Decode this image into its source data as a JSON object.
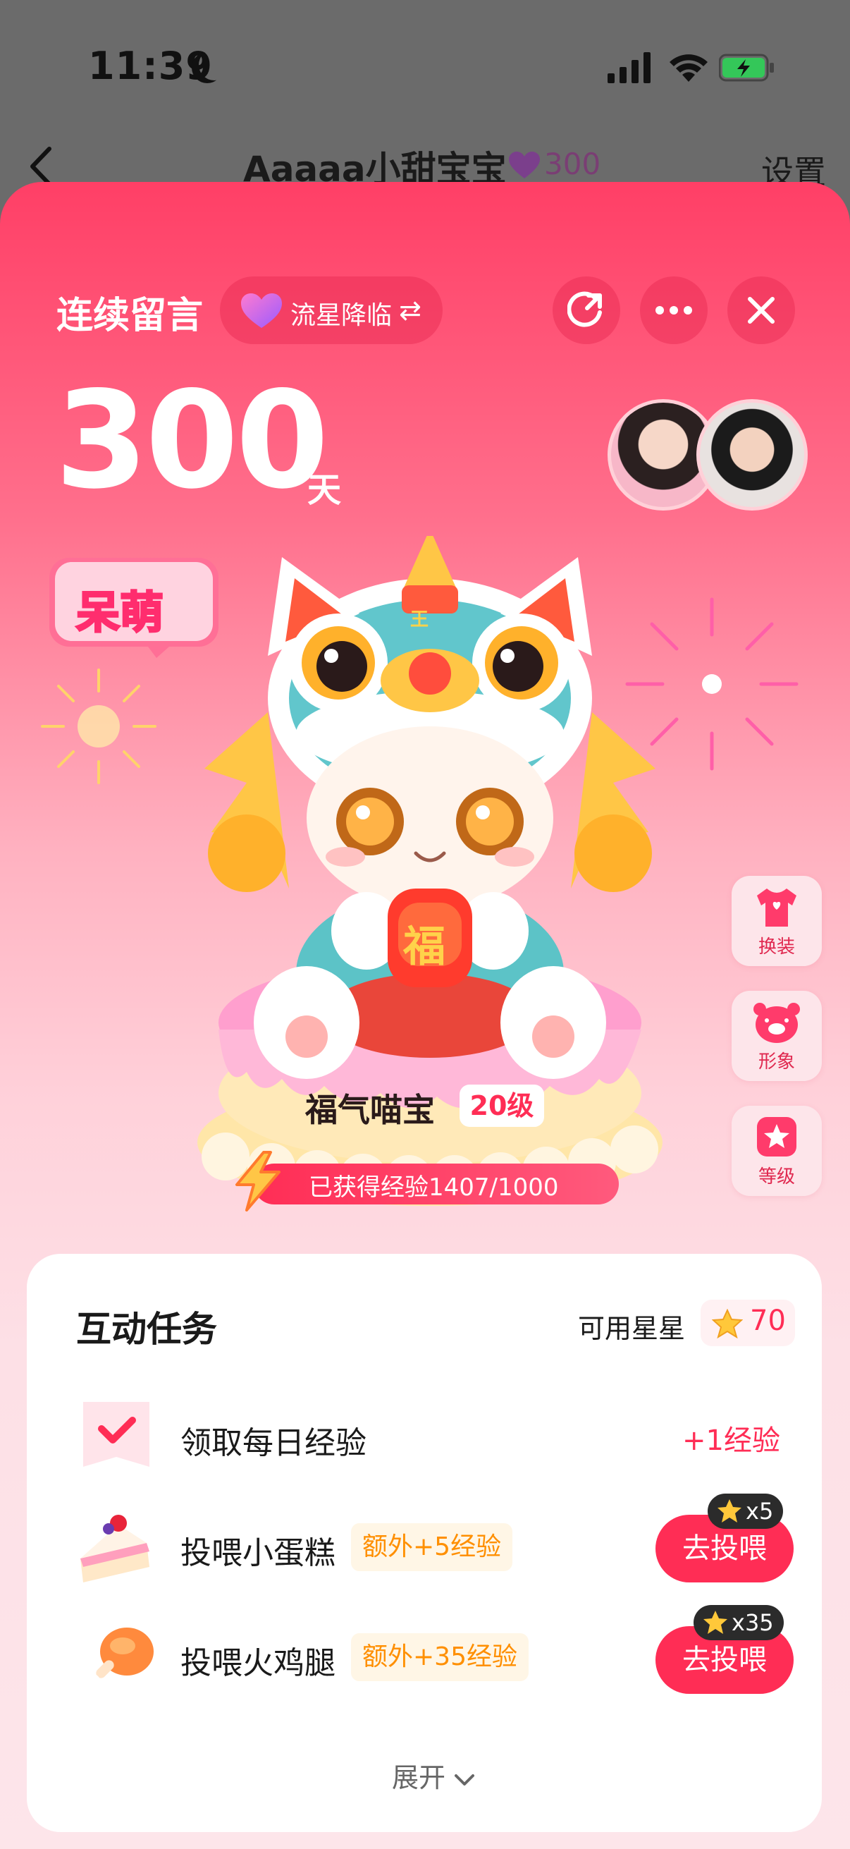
{
  "status_bar": {
    "time": "11:39"
  },
  "nav": {
    "title": "Aaaaa小甜宝宝",
    "count": "300",
    "settings": "设置"
  },
  "header": {
    "title": "连续留言",
    "effect_label": "流星降临",
    "swap_icon": "⇄"
  },
  "streak": {
    "days": "300",
    "unit": "天"
  },
  "badge": {
    "text": "呆萌"
  },
  "pet": {
    "name": "福气喵宝",
    "level": "20级",
    "xp_text": "已获得经验1407/1000",
    "lantern_char": "福",
    "crown_char": "王"
  },
  "side_buttons": [
    {
      "label": "换装",
      "icon": "outfit-icon"
    },
    {
      "label": "形象",
      "icon": "pig-face-icon"
    },
    {
      "label": "等级",
      "icon": "star-icon"
    }
  ],
  "tasks": {
    "title": "互动任务",
    "stars_label": "可用星星",
    "stars_count": "70",
    "items": [
      {
        "name": "领取每日经验",
        "reward": "+1经验",
        "icon": "check-ribbon-icon"
      },
      {
        "name": "投喂小蛋糕",
        "extra": "额外+5经验",
        "action": "去投喂",
        "cost": "x5",
        "icon": "cake-icon"
      },
      {
        "name": "投喂火鸡腿",
        "extra": "额外+35经验",
        "action": "去投喂",
        "cost": "x35",
        "icon": "drumstick-icon"
      }
    ],
    "expand": "展开"
  },
  "colors": {
    "accent": "#ff2d55",
    "sheet_top": "#ff3f66",
    "tag_text": "#ff8f00"
  }
}
